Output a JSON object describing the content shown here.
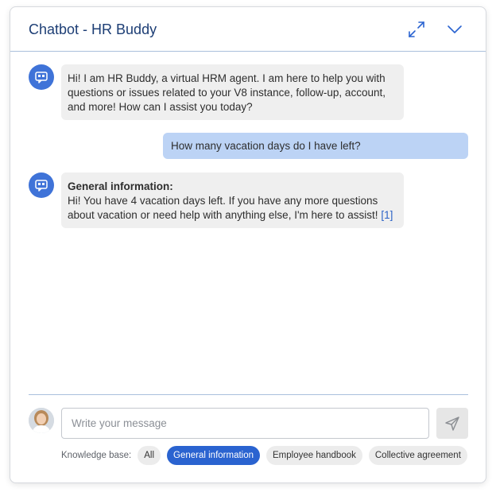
{
  "header": {
    "title": "Chatbot - HR Buddy",
    "expand_icon": "expand-arrows-icon",
    "collapse_icon": "chevron-down-icon"
  },
  "messages": [
    {
      "sender": "bot",
      "text": "Hi! I am HR Buddy, a virtual HRM agent. I am here to help you with questions or issues related to your V8 instance, follow-up, account, and more! How can I assist you today?"
    },
    {
      "sender": "user",
      "text": "How many vacation days do I have left?"
    },
    {
      "sender": "bot",
      "heading": "General information:",
      "text": "Hi! You have 4 vacation days left. If you have any more questions about vacation or need help with anything else, I'm here to assist!",
      "citation": "[1]"
    }
  ],
  "composer": {
    "placeholder": "Write your message",
    "value": "",
    "send_icon": "send-icon"
  },
  "knowledge_base": {
    "label": "Knowledge base:",
    "options": [
      "All",
      "General information",
      "Employee handbook",
      "Collective agreement"
    ],
    "selected": "General information"
  },
  "colors": {
    "accent": "#2a63d0",
    "title": "#1d3e75",
    "bot_avatar": "#3f73d8",
    "user_bubble": "#bcd3f5",
    "bot_bubble": "#efefef"
  }
}
